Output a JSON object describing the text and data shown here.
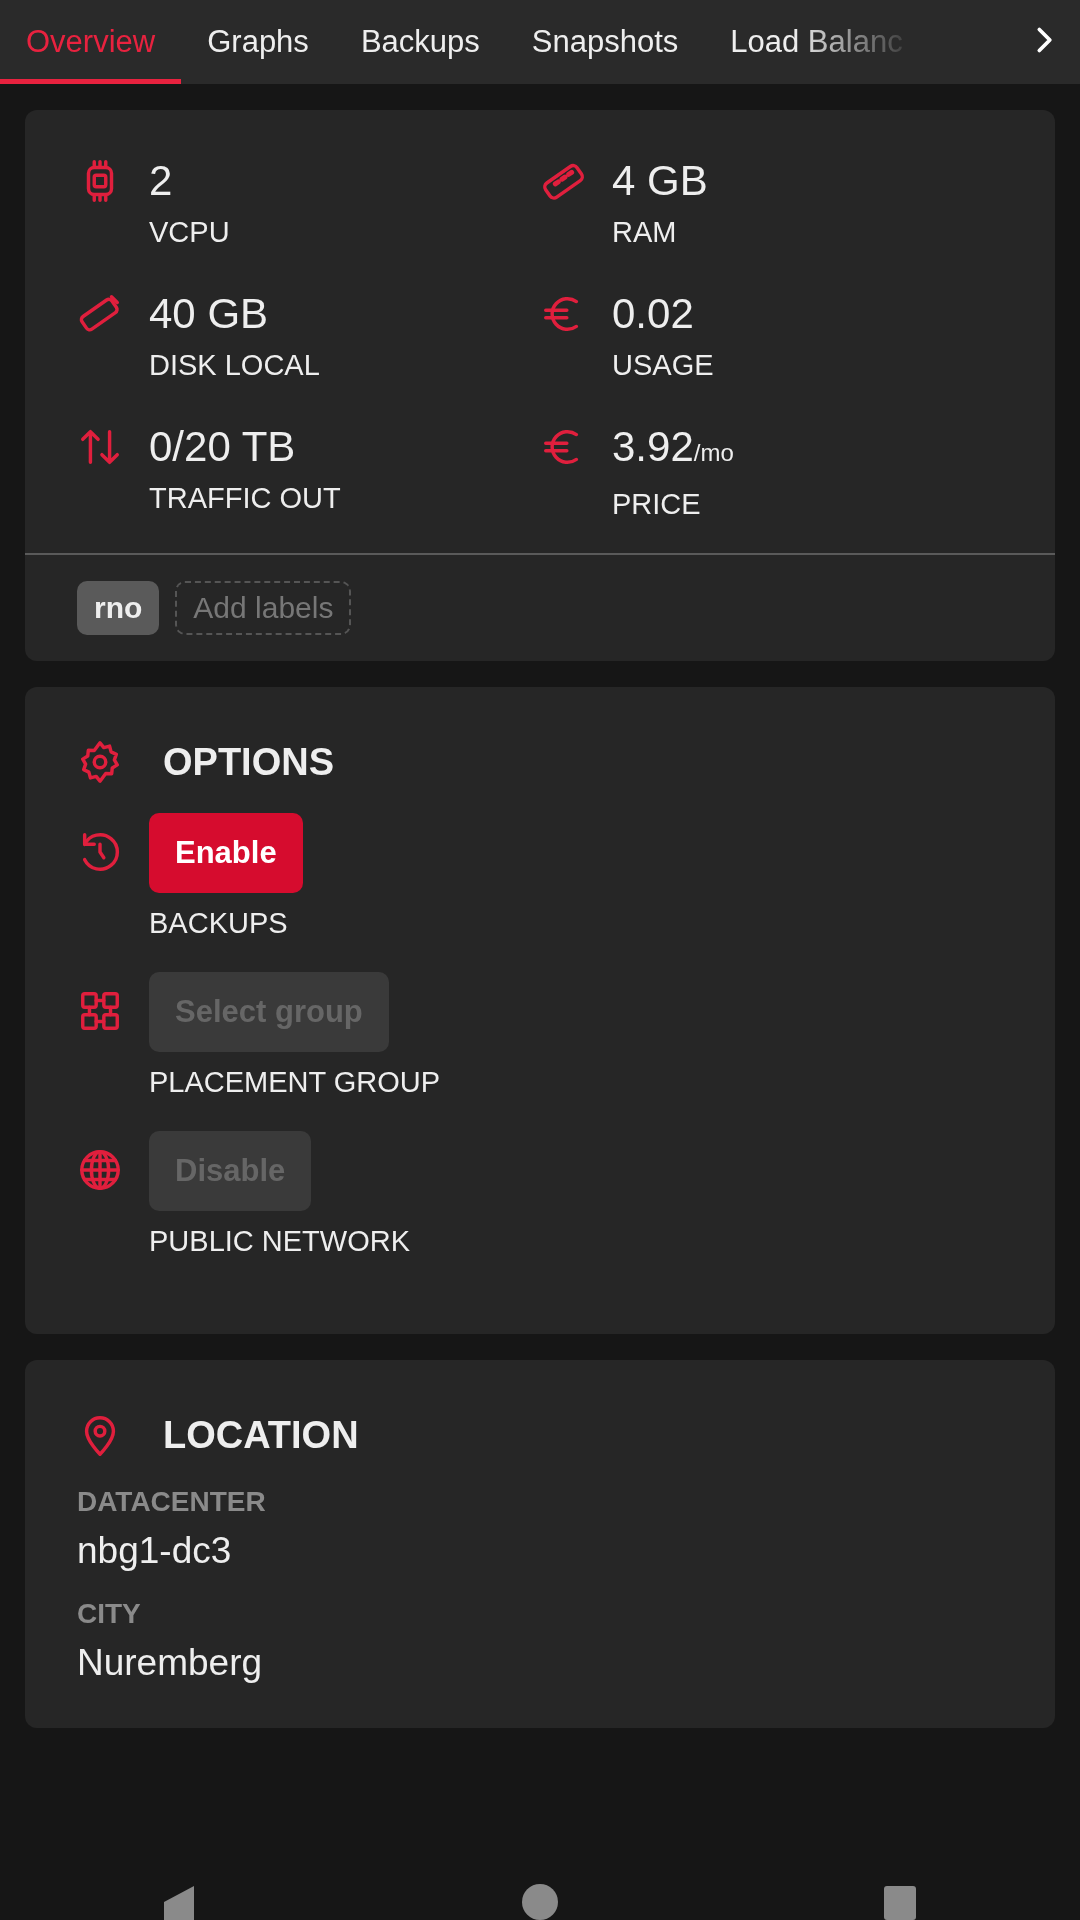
{
  "tabs": [
    {
      "label": "Overview",
      "selected": true
    },
    {
      "label": "Graphs",
      "selected": false
    },
    {
      "label": "Backups",
      "selected": false
    },
    {
      "label": "Snapshots",
      "selected": false
    },
    {
      "label": "Load Balanc",
      "selected": false
    }
  ],
  "specs": [
    {
      "kind": "cpu",
      "value": "2",
      "label": "VCPU"
    },
    {
      "kind": "ram",
      "value": "4 GB",
      "label": "RAM"
    },
    {
      "kind": "disk",
      "value": "40 GB",
      "label": "DISK LOCAL"
    },
    {
      "kind": "euro",
      "value": "0.02",
      "label": "USAGE"
    },
    {
      "kind": "traffic",
      "value": "0/20 TB",
      "label": "TRAFFIC OUT"
    },
    {
      "kind": "euro",
      "value": "3.92",
      "unit": "/mo",
      "label": "PRICE"
    }
  ],
  "labels": [
    {
      "kind": "tag",
      "text": "rno"
    },
    {
      "kind": "add",
      "text": "Add labels"
    }
  ],
  "options": {
    "title": "OPTIONS",
    "items": [
      {
        "kind": "backup",
        "button": "Enable",
        "disabled": false,
        "label": "BACKUPS"
      },
      {
        "kind": "placement",
        "button": "Select group",
        "disabled": true,
        "label": "PLACEMENT GROUP"
      },
      {
        "kind": "network",
        "button": "Disable",
        "disabled": true,
        "label": "PUBLIC NETWORK"
      }
    ]
  },
  "location": {
    "title": "LOCATION",
    "fields": [
      {
        "label": "DATACENTER",
        "value": "nbg1-dc3"
      },
      {
        "label": "CITY",
        "value": "Nuremberg"
      }
    ]
  }
}
